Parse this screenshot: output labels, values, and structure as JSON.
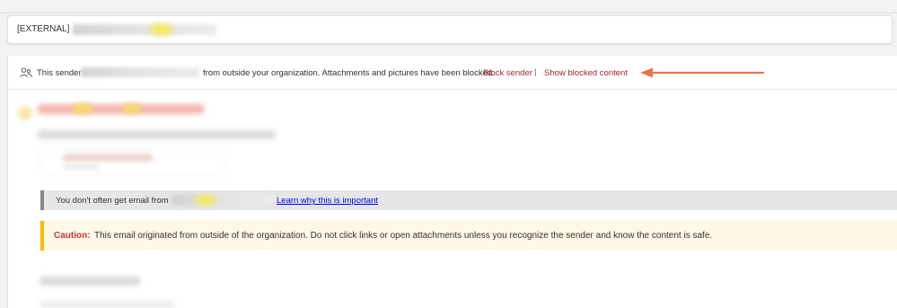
{
  "subject": {
    "tag": "[EXTERNAL]"
  },
  "infobar": {
    "text_before": "This sender",
    "text_after": "from outside your organization. Attachments and pictures have been blocked.",
    "block_sender_label": "Block sender",
    "separator": "|",
    "show_blocked_label": "Show blocked content",
    "link_color": "#a4262c",
    "icon": "people-icon"
  },
  "annotation": {
    "arrow_color": "#e8744f"
  },
  "notice": {
    "text": "You don't often get email from",
    "link_label": "Learn why this is important"
  },
  "caution": {
    "label": "Caution:",
    "message": "This email originated from outside of the organization. Do not click links or open attachments unless you recognize the sender and know the content is safe.",
    "accent_color": "#ffb900"
  }
}
